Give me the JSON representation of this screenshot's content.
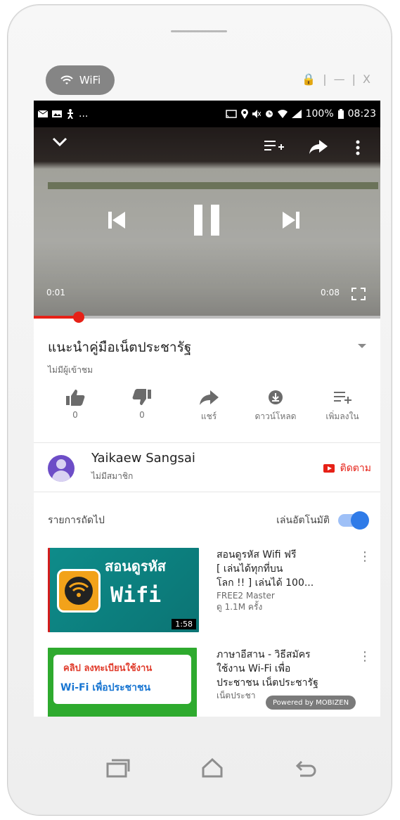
{
  "window": {
    "wifi_label": "WiFi",
    "controls": [
      "🔒",
      "|",
      "—",
      "|",
      "X"
    ]
  },
  "status": {
    "left_icons": [
      "mail-icon",
      "image-icon",
      "walk-icon"
    ],
    "left_more": "...",
    "battery": "100%",
    "time": "08:23"
  },
  "player": {
    "elapsed": "0:01",
    "duration": "0:08",
    "progress_fraction": 0.13
  },
  "video": {
    "title": "แนะนำคู่มือเน็ตประชารัฐ",
    "views": "ไม่มีผู้เข้าชม"
  },
  "actions": [
    {
      "icon": "thumbs-up-icon",
      "label": "0"
    },
    {
      "icon": "thumbs-down-icon",
      "label": "0"
    },
    {
      "icon": "share-icon",
      "label": "แชร์"
    },
    {
      "icon": "download-icon",
      "label": "ดาวน์โหลด"
    },
    {
      "icon": "add-to-playlist-icon",
      "label": "เพิ่มลงใน"
    }
  ],
  "channel": {
    "name": "Yaikaew Sangsai",
    "subscribers": "ไม่มีสมาชิก",
    "subscribe_label": "ติดตาม"
  },
  "upnext": {
    "label": "รายการถัดไป",
    "autoplay_label": "เล่นอัตโนมัติ",
    "autoplay_on": true
  },
  "playlist": [
    {
      "thumb_line1": "สอนดูรหัส",
      "thumb_line2": "Wifi",
      "duration": "1:58",
      "title_lines": [
        "สอนดูรหัส Wifi ฟรี",
        "[ เล่นได้ทุกที่บน",
        "โลก !! ] เล่นได้ 100..."
      ],
      "channel": "FREE2 Master",
      "views": "ดู 1.1M ครั้ง"
    },
    {
      "thumb_line1": "คลิป ลงทะเบียนใช้งาน",
      "thumb_line2": "Wi-Fi เพื่อประชาชน",
      "title_lines": [
        "ภาษาอีสาน - วิธีสมัคร",
        "ใช้งาน Wi-Fi เพื่อ",
        "ประชาชน เน็ตประชารัฐ"
      ],
      "channel": "เน็ตประชา"
    }
  ],
  "powered_by": "Powered by MOBIZEN"
}
